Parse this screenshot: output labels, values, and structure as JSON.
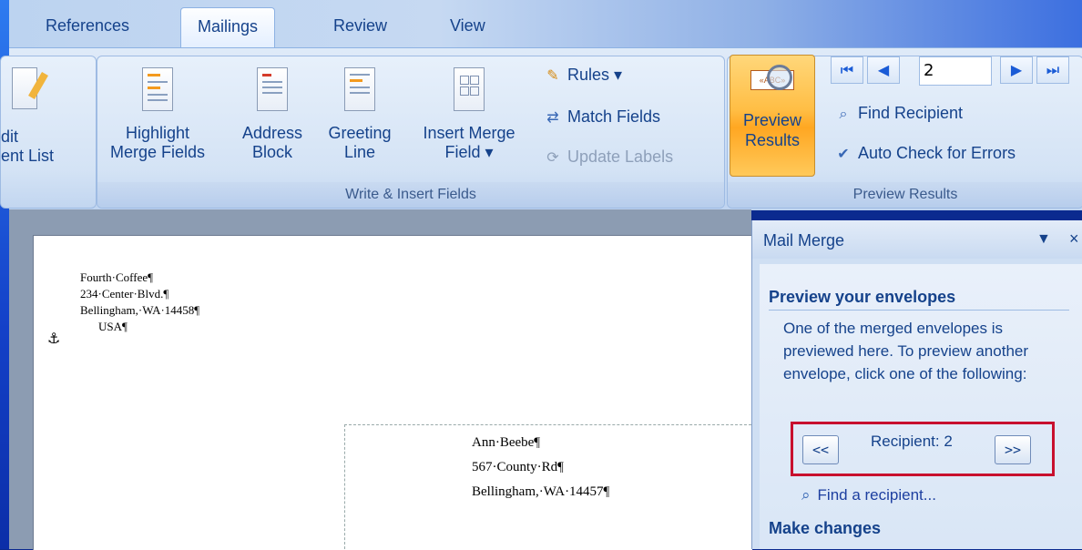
{
  "tabs": [
    {
      "label": "References"
    },
    {
      "label": "Mailings"
    },
    {
      "label": "Review"
    },
    {
      "label": "View"
    }
  ],
  "ribbon": {
    "edit_list": {
      "line1": "dit",
      "line2": "ent List"
    },
    "write_insert": {
      "group_label": "Write & Insert Fields",
      "highlight": {
        "line1": "Highlight",
        "line2": "Merge Fields"
      },
      "address": {
        "line1": "Address",
        "line2": "Block"
      },
      "greeting": {
        "line1": "Greeting",
        "line2": "Line"
      },
      "insert_merge": {
        "line1": "Insert Merge",
        "line2": "Field ▾"
      },
      "rules": "Rules ▾",
      "match_fields": "Match Fields",
      "update_labels": "Update Labels"
    },
    "preview": {
      "group_label": "Preview Results",
      "preview_btn": {
        "line1": "Preview",
        "line2": "Results"
      },
      "recipient_number": "2",
      "find_recipient": "Find Recipient",
      "auto_check": "Auto Check for Errors"
    }
  },
  "document": {
    "sender": [
      "Fourth·Coffee¶",
      "234·Center·Blvd.¶",
      "Bellingham,·WA·14458¶",
      "USA¶"
    ],
    "recipient": [
      "Ann·Beebe¶",
      "567·County·Rd¶",
      "Bellingham,·WA·14457¶"
    ]
  },
  "pane": {
    "title": "Mail Merge",
    "heading": "Preview your envelopes",
    "description": "One of the merged envelopes is previewed here. To preview another envelope, click one of the following:",
    "prev_label": "<<",
    "recipient_label": "Recipient: 2",
    "next_label": ">>",
    "find_link": "Find a recipient...",
    "make_changes": "Make changes"
  },
  "colors": {
    "accent": "#15428b",
    "highlight_box": "#c8102e",
    "preview_active": "#ffbe45"
  }
}
